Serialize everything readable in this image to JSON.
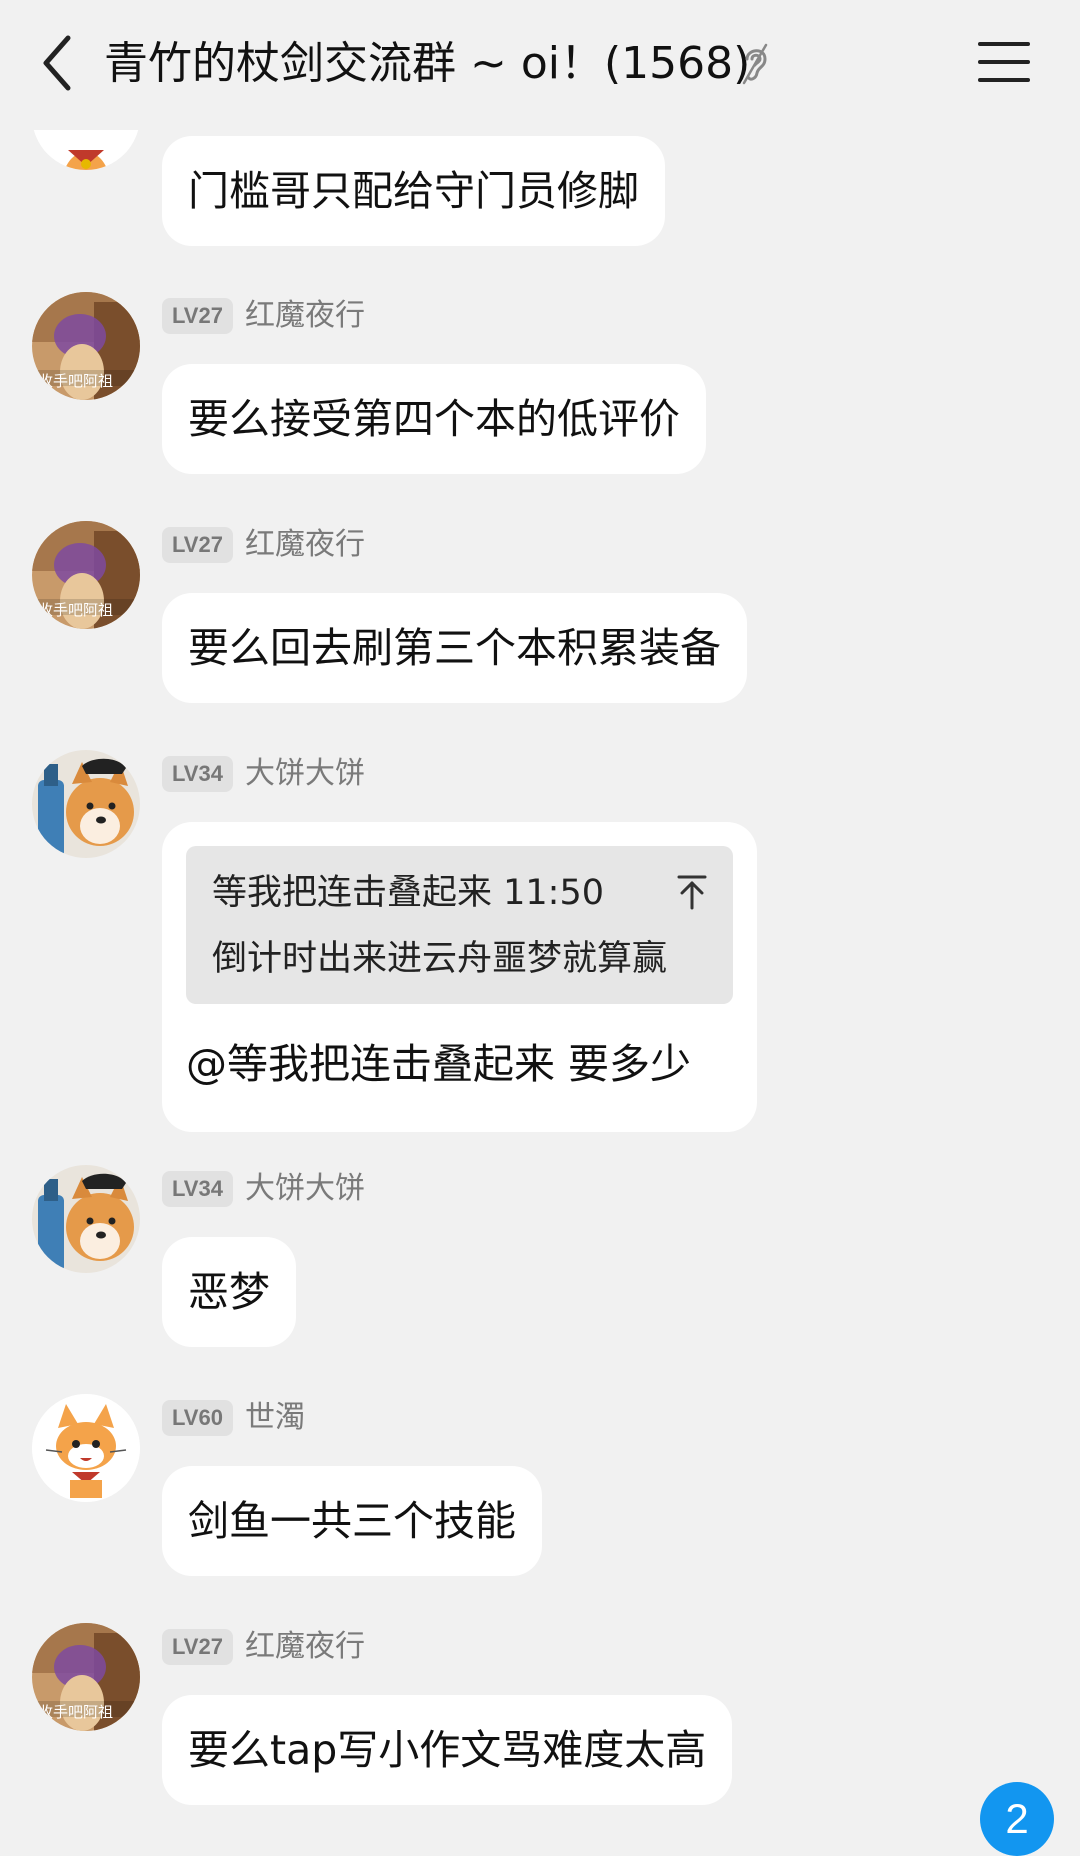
{
  "header": {
    "title": "青竹的杖剑交流群 ~ oi！(1568)"
  },
  "messages": [
    {
      "level": "",
      "nick": "",
      "text": "门槛哥只配给守门员修脚",
      "avatar": "cat-avatar"
    },
    {
      "level": "LV27",
      "nick": "红魔夜行",
      "text": "要么接受第四个本的低评价",
      "avatar": "dog-photo-avatar"
    },
    {
      "level": "LV27",
      "nick": "红魔夜行",
      "text": "要么回去刷第三个本积累装备",
      "avatar": "dog-photo-avatar"
    },
    {
      "level": "LV34",
      "nick": "大饼大饼",
      "avatar": "shiba-avatar",
      "quote_line1": "等我把连击叠起来 11:50",
      "quote_line2": "倒计时出来进云舟噩梦就算赢",
      "text": "@等我把连击叠起来 要多少"
    },
    {
      "level": "LV34",
      "nick": "大饼大饼",
      "text": "恶梦",
      "avatar": "shiba-avatar"
    },
    {
      "level": "LV60",
      "nick": "世濁",
      "text": "剑鱼一共三个技能",
      "avatar": "cat-avatar"
    },
    {
      "level": "LV27",
      "nick": "红魔夜行",
      "text": "要么tap写小作文骂难度太高",
      "avatar": "dog-photo-avatar"
    }
  ],
  "avatar_caption": "收手吧阿祖",
  "unread_count": "2",
  "colors": {
    "background": "#f1f1f1",
    "bubble": "#ffffff",
    "badge": "#1296f0"
  }
}
